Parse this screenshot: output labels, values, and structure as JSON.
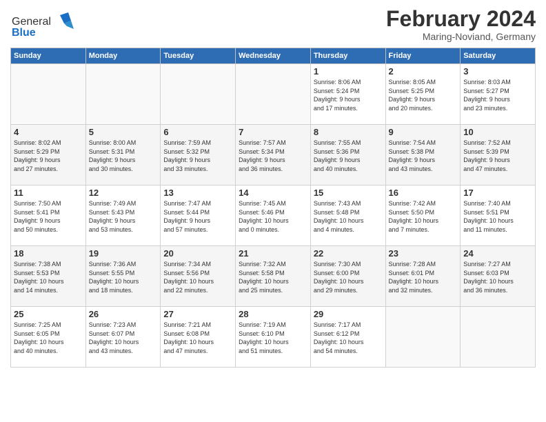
{
  "header": {
    "logo_general": "General",
    "logo_blue": "Blue",
    "month_year": "February 2024",
    "location": "Maring-Noviand, Germany"
  },
  "days_of_week": [
    "Sunday",
    "Monday",
    "Tuesday",
    "Wednesday",
    "Thursday",
    "Friday",
    "Saturday"
  ],
  "weeks": [
    [
      {
        "day": "",
        "info": ""
      },
      {
        "day": "",
        "info": ""
      },
      {
        "day": "",
        "info": ""
      },
      {
        "day": "",
        "info": ""
      },
      {
        "day": "1",
        "info": "Sunrise: 8:06 AM\nSunset: 5:24 PM\nDaylight: 9 hours\nand 17 minutes."
      },
      {
        "day": "2",
        "info": "Sunrise: 8:05 AM\nSunset: 5:25 PM\nDaylight: 9 hours\nand 20 minutes."
      },
      {
        "day": "3",
        "info": "Sunrise: 8:03 AM\nSunset: 5:27 PM\nDaylight: 9 hours\nand 23 minutes."
      }
    ],
    [
      {
        "day": "4",
        "info": "Sunrise: 8:02 AM\nSunset: 5:29 PM\nDaylight: 9 hours\nand 27 minutes."
      },
      {
        "day": "5",
        "info": "Sunrise: 8:00 AM\nSunset: 5:31 PM\nDaylight: 9 hours\nand 30 minutes."
      },
      {
        "day": "6",
        "info": "Sunrise: 7:59 AM\nSunset: 5:32 PM\nDaylight: 9 hours\nand 33 minutes."
      },
      {
        "day": "7",
        "info": "Sunrise: 7:57 AM\nSunset: 5:34 PM\nDaylight: 9 hours\nand 36 minutes."
      },
      {
        "day": "8",
        "info": "Sunrise: 7:55 AM\nSunset: 5:36 PM\nDaylight: 9 hours\nand 40 minutes."
      },
      {
        "day": "9",
        "info": "Sunrise: 7:54 AM\nSunset: 5:38 PM\nDaylight: 9 hours\nand 43 minutes."
      },
      {
        "day": "10",
        "info": "Sunrise: 7:52 AM\nSunset: 5:39 PM\nDaylight: 9 hours\nand 47 minutes."
      }
    ],
    [
      {
        "day": "11",
        "info": "Sunrise: 7:50 AM\nSunset: 5:41 PM\nDaylight: 9 hours\nand 50 minutes."
      },
      {
        "day": "12",
        "info": "Sunrise: 7:49 AM\nSunset: 5:43 PM\nDaylight: 9 hours\nand 53 minutes."
      },
      {
        "day": "13",
        "info": "Sunrise: 7:47 AM\nSunset: 5:44 PM\nDaylight: 9 hours\nand 57 minutes."
      },
      {
        "day": "14",
        "info": "Sunrise: 7:45 AM\nSunset: 5:46 PM\nDaylight: 10 hours\nand 0 minutes."
      },
      {
        "day": "15",
        "info": "Sunrise: 7:43 AM\nSunset: 5:48 PM\nDaylight: 10 hours\nand 4 minutes."
      },
      {
        "day": "16",
        "info": "Sunrise: 7:42 AM\nSunset: 5:50 PM\nDaylight: 10 hours\nand 7 minutes."
      },
      {
        "day": "17",
        "info": "Sunrise: 7:40 AM\nSunset: 5:51 PM\nDaylight: 10 hours\nand 11 minutes."
      }
    ],
    [
      {
        "day": "18",
        "info": "Sunrise: 7:38 AM\nSunset: 5:53 PM\nDaylight: 10 hours\nand 14 minutes."
      },
      {
        "day": "19",
        "info": "Sunrise: 7:36 AM\nSunset: 5:55 PM\nDaylight: 10 hours\nand 18 minutes."
      },
      {
        "day": "20",
        "info": "Sunrise: 7:34 AM\nSunset: 5:56 PM\nDaylight: 10 hours\nand 22 minutes."
      },
      {
        "day": "21",
        "info": "Sunrise: 7:32 AM\nSunset: 5:58 PM\nDaylight: 10 hours\nand 25 minutes."
      },
      {
        "day": "22",
        "info": "Sunrise: 7:30 AM\nSunset: 6:00 PM\nDaylight: 10 hours\nand 29 minutes."
      },
      {
        "day": "23",
        "info": "Sunrise: 7:28 AM\nSunset: 6:01 PM\nDaylight: 10 hours\nand 32 minutes."
      },
      {
        "day": "24",
        "info": "Sunrise: 7:27 AM\nSunset: 6:03 PM\nDaylight: 10 hours\nand 36 minutes."
      }
    ],
    [
      {
        "day": "25",
        "info": "Sunrise: 7:25 AM\nSunset: 6:05 PM\nDaylight: 10 hours\nand 40 minutes."
      },
      {
        "day": "26",
        "info": "Sunrise: 7:23 AM\nSunset: 6:07 PM\nDaylight: 10 hours\nand 43 minutes."
      },
      {
        "day": "27",
        "info": "Sunrise: 7:21 AM\nSunset: 6:08 PM\nDaylight: 10 hours\nand 47 minutes."
      },
      {
        "day": "28",
        "info": "Sunrise: 7:19 AM\nSunset: 6:10 PM\nDaylight: 10 hours\nand 51 minutes."
      },
      {
        "day": "29",
        "info": "Sunrise: 7:17 AM\nSunset: 6:12 PM\nDaylight: 10 hours\nand 54 minutes."
      },
      {
        "day": "",
        "info": ""
      },
      {
        "day": "",
        "info": ""
      }
    ]
  ]
}
